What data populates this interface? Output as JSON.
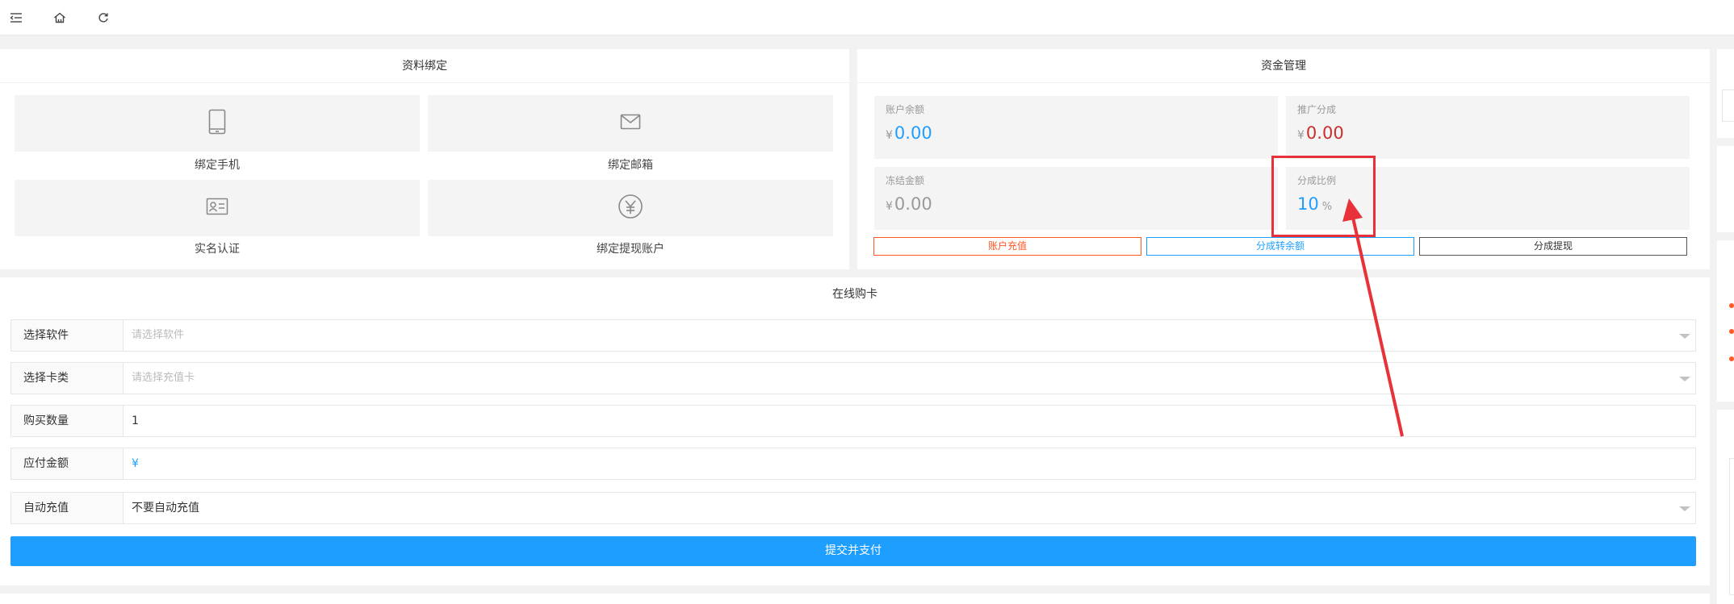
{
  "topbar": {
    "menu_icon": "menu-fold-icon",
    "home_icon": "home-icon",
    "refresh_icon": "refresh-icon"
  },
  "bind": {
    "title": "资料绑定",
    "items": [
      {
        "label": "绑定手机",
        "icon": "phone-icon"
      },
      {
        "label": "绑定邮箱",
        "icon": "email-icon"
      },
      {
        "label": "实名认证",
        "icon": "id-card-icon"
      },
      {
        "label": "绑定提现账户",
        "icon": "yuan-icon"
      }
    ]
  },
  "funds": {
    "title": "资金管理",
    "currency": "¥",
    "balance": {
      "label": "账户余额",
      "value": "0.00"
    },
    "commission": {
      "label": "推广分成",
      "value": "0.00"
    },
    "frozen": {
      "label": "冻结金额",
      "value": "0.00"
    },
    "ratio": {
      "label": "分成比例",
      "value": "10",
      "unit": "%"
    },
    "buttons": {
      "recharge": "账户充值",
      "transfer": "分成转余额",
      "withdraw": "分成提现"
    },
    "colors": {
      "blue": "#1e9fff",
      "red": "#c9302c",
      "orange": "#ff5722",
      "gray": "#999999"
    }
  },
  "purchase": {
    "title": "在线购卡",
    "fields": {
      "software": {
        "label": "选择软件",
        "placeholder": "请选择软件"
      },
      "card_type": {
        "label": "选择卡类",
        "placeholder": "请选择充值卡"
      },
      "quantity": {
        "label": "购买数量",
        "value": "1"
      },
      "amount": {
        "label": "应付金额",
        "value": "¥"
      },
      "auto_recharge": {
        "label": "自动充值",
        "value": "不要自动充值"
      }
    },
    "submit_label": "提交并支付"
  },
  "annotation": {
    "color": "#e8323a"
  }
}
